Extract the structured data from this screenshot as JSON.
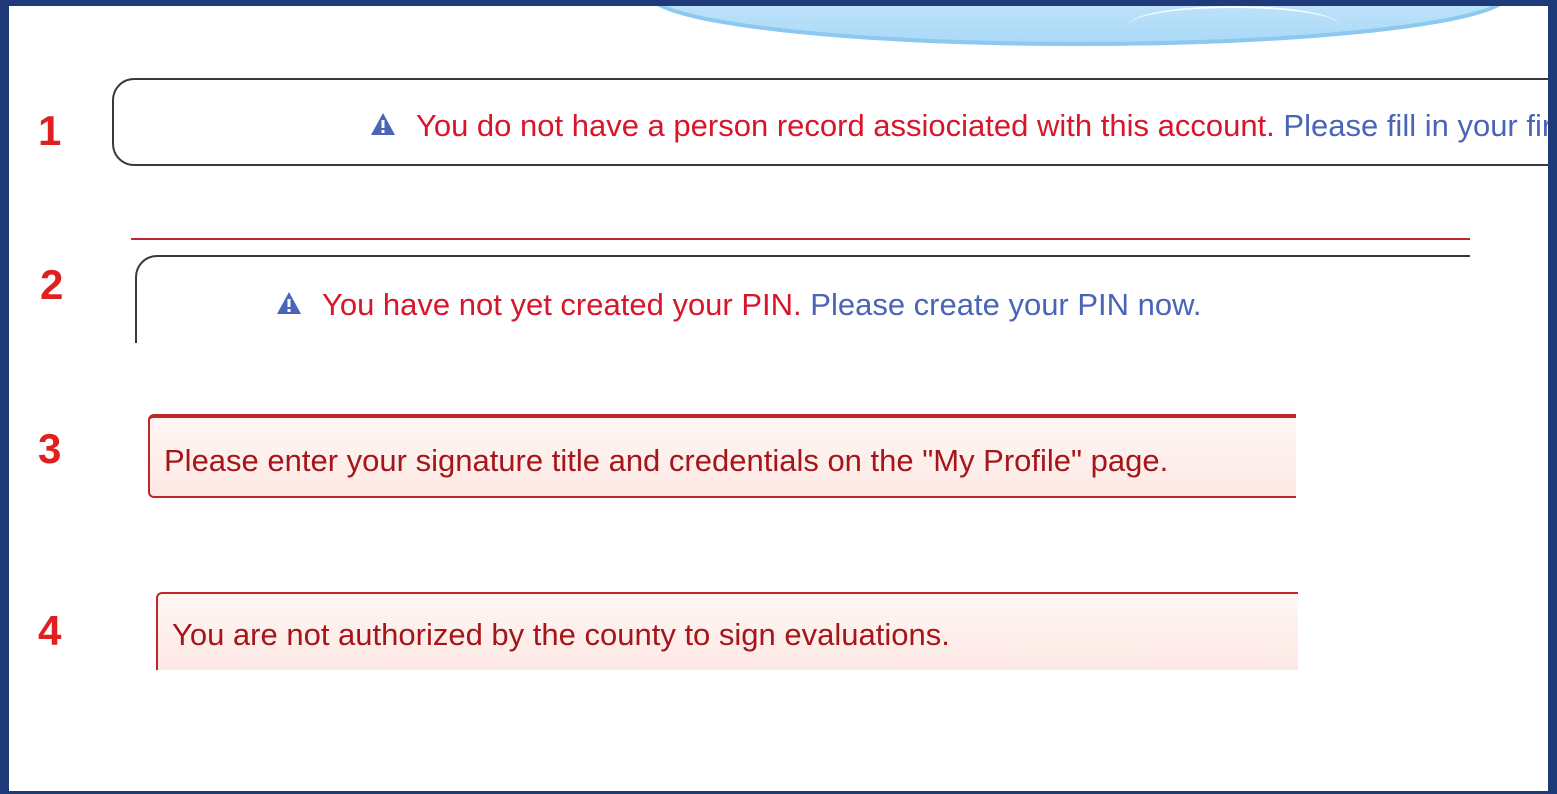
{
  "steps": [
    "1",
    "2",
    "3",
    "4"
  ],
  "alerts": {
    "person_record": {
      "icon": "warning-triangle-icon",
      "message": "You do not have a person record assiociated with this account.",
      "link_text": "Please fill in your first"
    },
    "pin": {
      "icon": "warning-triangle-icon",
      "message": "You have not yet created your PIN.",
      "link_text": "Please create your PIN now."
    },
    "signature": {
      "message": "Please enter your signature title and credentials on the \"My Profile\" page."
    },
    "authorization": {
      "message": "You are not authorized by the county to sign evaluations."
    }
  },
  "colors": {
    "frame": "#1e3a78",
    "step_number": "#e02020",
    "alert_text": "#d8152a",
    "link_text": "#4a64b8",
    "icon": "#4a64b8",
    "error_border": "#c0262d",
    "error_text": "#a4161a"
  }
}
